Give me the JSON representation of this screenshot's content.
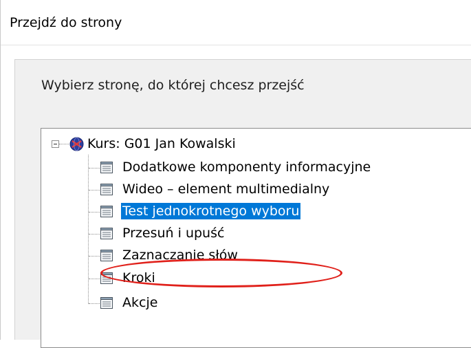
{
  "dialog": {
    "title": "Przejdź do strony",
    "prompt": "Wybierz stronę, do której chcesz przejść"
  },
  "tree": {
    "root": {
      "label": "Kurs: G01 Jan Kowalski",
      "icon": "course-globe-icon",
      "expanded": true
    },
    "items": [
      {
        "label": "Dodatkowe komponenty informacyjne",
        "icon": "page-icon",
        "selected": false
      },
      {
        "label": "Wideo – element multimedialny",
        "icon": "page-icon",
        "selected": false
      },
      {
        "label": "Test jednokrotnego wyboru",
        "icon": "page-icon",
        "selected": true
      },
      {
        "label": "Przesuń i upuść",
        "icon": "page-icon",
        "selected": false
      },
      {
        "label": "Zaznaczanie słów",
        "icon": "page-icon",
        "selected": false
      },
      {
        "label": "Kroki",
        "icon": "page-icon",
        "selected": false
      },
      {
        "label": "Akcje",
        "icon": "page-icon",
        "selected": false
      }
    ]
  },
  "colors": {
    "selection": "#0078d7",
    "highlight_circle": "#e0201a"
  }
}
